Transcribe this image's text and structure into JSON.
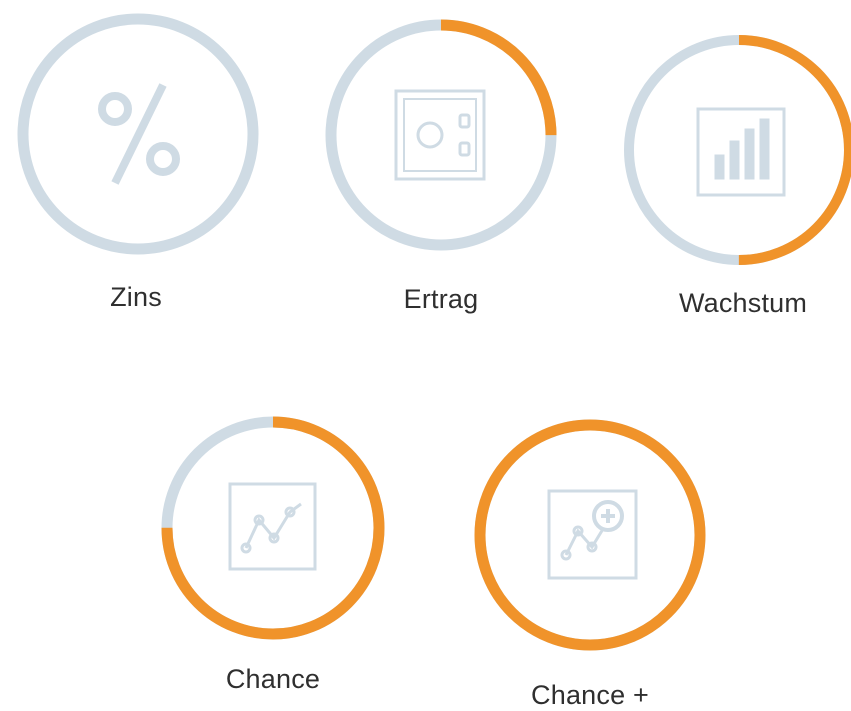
{
  "colors": {
    "track": "#cfdbe4",
    "progress": "#f0932a",
    "icon": "#cfdbe4",
    "label": "#2f2f2f",
    "background": "#ffffff"
  },
  "options": [
    {
      "label": "Zins",
      "icon": "percent-icon",
      "level": 0
    },
    {
      "label": "Ertrag",
      "icon": "safe-icon",
      "level": 0.25
    },
    {
      "label": "Wachstum",
      "icon": "bar-chart-icon",
      "level": 0.5
    },
    {
      "label": "Chance",
      "icon": "line-chart-icon",
      "level": 0.75
    },
    {
      "label": "Chance +",
      "icon": "line-chart-plus-icon",
      "level": 1
    }
  ]
}
